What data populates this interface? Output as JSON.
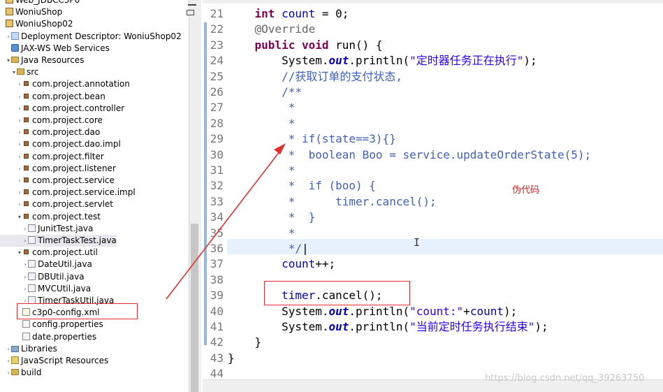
{
  "explorer": {
    "items": [
      {
        "label": "Web_JDBCC3P0",
        "icon": "project-icon",
        "twisty": "",
        "sel": false
      },
      {
        "label": "WoniuShop",
        "icon": "project-icon",
        "twisty": "",
        "sel": false
      },
      {
        "label": "WoniuShop02",
        "icon": "project-icon",
        "twisty": "",
        "sel": false
      },
      {
        "label": "Deployment Descriptor: WoniuShop02",
        "icon": "descriptor-icon",
        "twisty": "›",
        "sel": false
      },
      {
        "label": "JAX-WS Web Services",
        "icon": "web-services-icon",
        "twisty": "",
        "sel": false
      },
      {
        "label": "Java Resources",
        "icon": "java-resources-icon",
        "twisty": "▾",
        "sel": false
      },
      {
        "label": "src",
        "icon": "source-folder-icon",
        "twisty": "▾",
        "sel": false
      },
      {
        "label": "com.project.annotation",
        "icon": "package-icon",
        "twisty": "›",
        "sel": false
      },
      {
        "label": "com.project.bean",
        "icon": "package-icon",
        "twisty": "›",
        "sel": false
      },
      {
        "label": "com.project.controller",
        "icon": "package-icon",
        "twisty": "›",
        "sel": false
      },
      {
        "label": "com.project.core",
        "icon": "package-icon",
        "twisty": "›",
        "sel": false
      },
      {
        "label": "com.project.dao",
        "icon": "package-icon",
        "twisty": "›",
        "sel": false
      },
      {
        "label": "com.project.dao.impl",
        "icon": "package-icon",
        "twisty": "›",
        "sel": false
      },
      {
        "label": "com.project.filter",
        "icon": "package-icon",
        "twisty": "›",
        "sel": false
      },
      {
        "label": "com.project.listener",
        "icon": "package-icon",
        "twisty": "›",
        "sel": false
      },
      {
        "label": "com.project.service",
        "icon": "package-icon",
        "twisty": "›",
        "sel": false
      },
      {
        "label": "com.project.service.impl",
        "icon": "package-icon",
        "twisty": "›",
        "sel": false
      },
      {
        "label": "com.project.servlet",
        "icon": "package-icon",
        "twisty": "›",
        "sel": false
      },
      {
        "label": "com.project.test",
        "icon": "package-icon",
        "twisty": "▾",
        "sel": false
      },
      {
        "label": "JunitTest.java",
        "icon": "java-file-icon",
        "twisty": "›",
        "sel": false
      },
      {
        "label": "TimerTaskTest.java",
        "icon": "java-file-icon",
        "twisty": "›",
        "sel": true
      },
      {
        "label": "com.project.util",
        "icon": "package-icon",
        "twisty": "▾",
        "sel": false
      },
      {
        "label": "DateUtil.java",
        "icon": "java-file-icon",
        "twisty": "›",
        "sel": false
      },
      {
        "label": "DBUtil.java",
        "icon": "java-file-icon",
        "twisty": "›",
        "sel": false
      },
      {
        "label": "MVCUtil.java",
        "icon": "java-file-icon",
        "twisty": "›",
        "sel": false
      },
      {
        "label": "TimerTaskUtil.java",
        "icon": "java-file-icon",
        "twisty": "›",
        "sel": false
      },
      {
        "label": "c3p0-config.xml",
        "icon": "xml-file-icon",
        "twisty": "",
        "sel": false
      },
      {
        "label": "config.properties",
        "icon": "properties-file-icon",
        "twisty": "",
        "sel": false
      },
      {
        "label": "date.properties",
        "icon": "properties-file-icon",
        "twisty": "",
        "sel": false
      },
      {
        "label": "Libraries",
        "icon": "libraries-icon",
        "twisty": "›",
        "sel": false
      },
      {
        "label": "JavaScript Resources",
        "icon": "javascript-resources-icon",
        "twisty": "›",
        "sel": false
      },
      {
        "label": "build",
        "icon": "folder-icon",
        "twisty": "›",
        "sel": false
      }
    ]
  },
  "editor": {
    "lines": [
      {
        "num": "21",
        "segs": [
          {
            "t": "    "
          },
          {
            "t": "int",
            "c": "kw"
          },
          {
            "t": " "
          },
          {
            "t": "count",
            "c": "fld"
          },
          {
            "t": " = 0;"
          }
        ]
      },
      {
        "num": "22",
        "segs": [
          {
            "t": "    "
          },
          {
            "t": "@Override",
            "c": "ann"
          }
        ]
      },
      {
        "num": "23",
        "segs": [
          {
            "t": "    "
          },
          {
            "t": "public",
            "c": "kw"
          },
          {
            "t": " "
          },
          {
            "t": "void",
            "c": "kw"
          },
          {
            "t": " run() {"
          }
        ]
      },
      {
        "num": "24",
        "segs": [
          {
            "t": "        System."
          },
          {
            "t": "out",
            "c": "stat"
          },
          {
            "t": ".println("
          },
          {
            "t": "\"定时器任务正在执行\"",
            "c": "str"
          },
          {
            "t": ");"
          }
        ]
      },
      {
        "num": "25",
        "segs": [
          {
            "t": "        "
          },
          {
            "t": "//获取订单的支付状态,",
            "c": "cm"
          }
        ]
      },
      {
        "num": "26",
        "segs": [
          {
            "t": "        "
          },
          {
            "t": "/**",
            "c": "cm"
          }
        ]
      },
      {
        "num": "27",
        "segs": [
          {
            "t": "         ",
            "c": "cm"
          },
          {
            "t": "*",
            "c": "cm"
          }
        ]
      },
      {
        "num": "28",
        "segs": [
          {
            "t": "         ",
            "c": "cm"
          },
          {
            "t": "*",
            "c": "cm"
          }
        ]
      },
      {
        "num": "29",
        "segs": [
          {
            "t": "         * if(state==3){}",
            "c": "cm"
          }
        ]
      },
      {
        "num": "30",
        "segs": [
          {
            "t": "         *  boolean Boo = service.updateOrderState(5);",
            "c": "cm"
          }
        ]
      },
      {
        "num": "31",
        "segs": [
          {
            "t": "         *",
            "c": "cm"
          }
        ]
      },
      {
        "num": "32",
        "segs": [
          {
            "t": "         *  if (boo) {",
            "c": "cm"
          }
        ]
      },
      {
        "num": "33",
        "segs": [
          {
            "t": "         *      timer.cancel();",
            "c": "cm"
          }
        ]
      },
      {
        "num": "34",
        "segs": [
          {
            "t": "         *  }",
            "c": "cm"
          }
        ]
      },
      {
        "num": "35",
        "segs": [
          {
            "t": "         *",
            "c": "cm"
          }
        ]
      },
      {
        "num": "36",
        "segs": [
          {
            "t": "         */",
            "c": "cm"
          },
          {
            "t": "|"
          }
        ]
      },
      {
        "num": "37",
        "segs": [
          {
            "t": "        "
          },
          {
            "t": "count",
            "c": "fld"
          },
          {
            "t": "++;"
          }
        ]
      },
      {
        "num": "38",
        "segs": [
          {
            "t": ""
          }
        ]
      },
      {
        "num": "39",
        "segs": [
          {
            "t": "        "
          },
          {
            "t": "timer",
            "c": "fld"
          },
          {
            "t": ".cancel();"
          }
        ]
      },
      {
        "num": "40",
        "segs": [
          {
            "t": "        System."
          },
          {
            "t": "out",
            "c": "stat"
          },
          {
            "t": ".println("
          },
          {
            "t": "\"count:\"",
            "c": "str"
          },
          {
            "t": "+"
          },
          {
            "t": "count",
            "c": "fld"
          },
          {
            "t": ");"
          }
        ]
      },
      {
        "num": "41",
        "segs": [
          {
            "t": "        System."
          },
          {
            "t": "out",
            "c": "stat"
          },
          {
            "t": ".println("
          },
          {
            "t": "\"当前定时任务执行结束\"",
            "c": "str"
          },
          {
            "t": ");"
          }
        ]
      },
      {
        "num": "42",
        "segs": [
          {
            "t": "    }"
          }
        ]
      },
      {
        "num": "43",
        "segs": [
          {
            "t": "}"
          }
        ]
      },
      {
        "num": "44",
        "segs": [
          {
            "t": ""
          }
        ]
      }
    ]
  },
  "annotations": {
    "pseudo_code_label": "伪代码",
    "accent_color": "#e23030"
  },
  "cursor_glyph": "I",
  "watermark": "https://blog.csdn.net/qq_39263750"
}
